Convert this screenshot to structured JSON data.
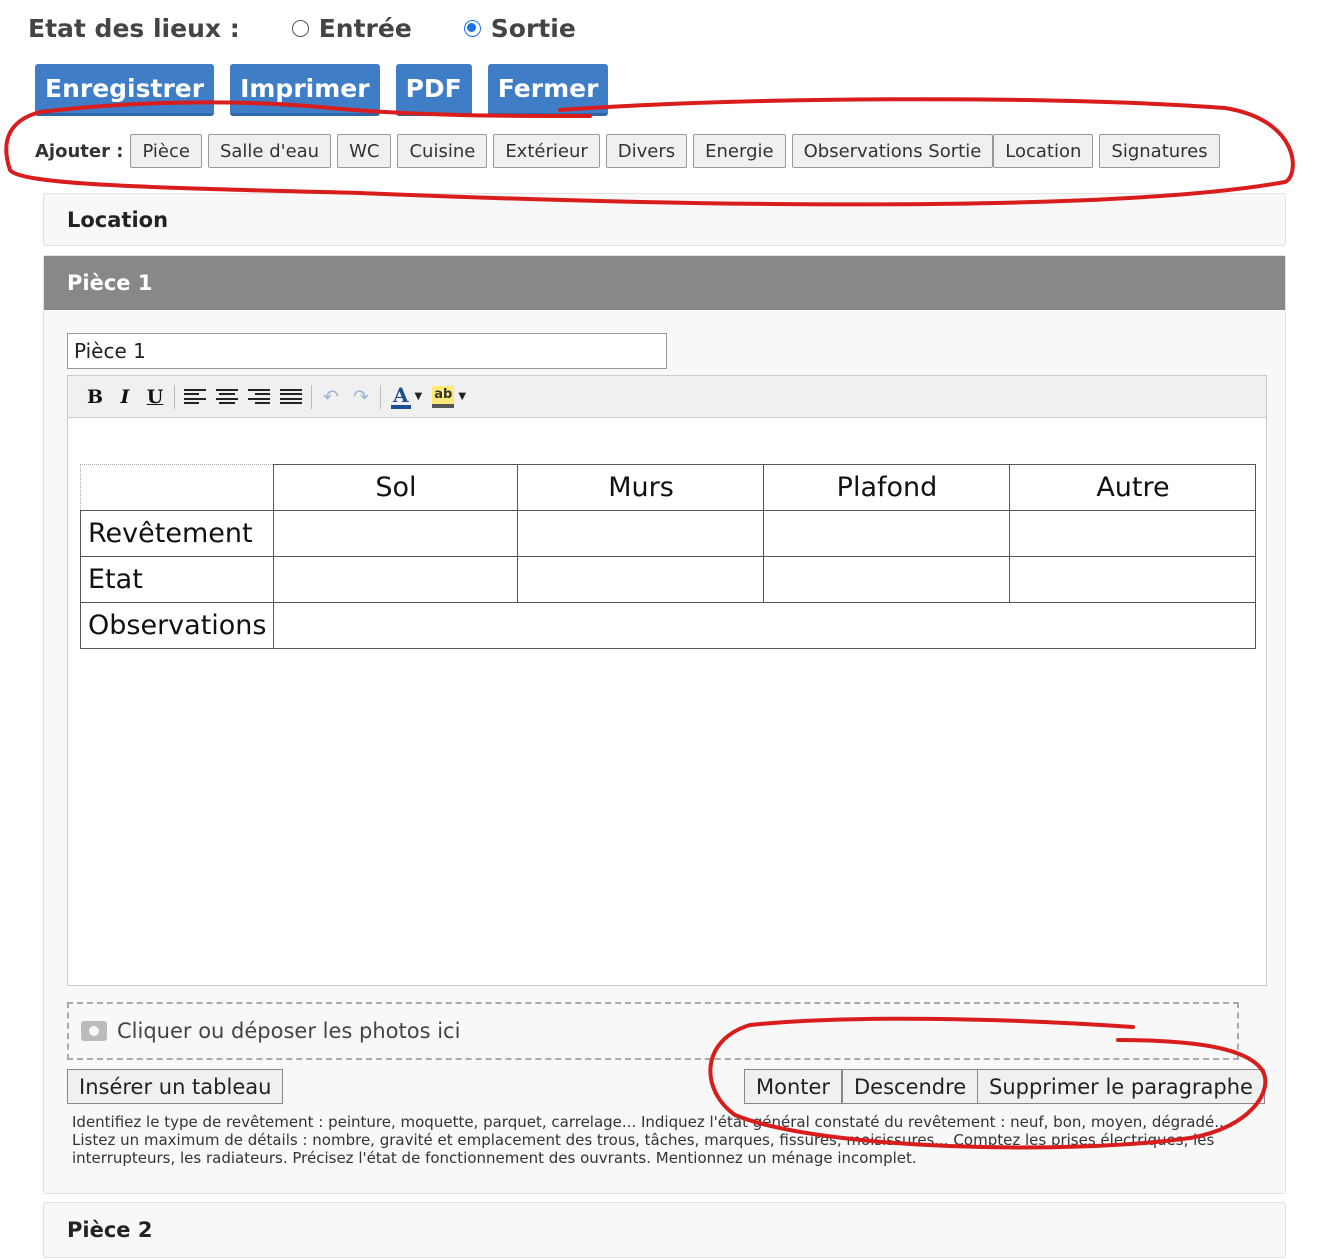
{
  "header": {
    "label": "Etat des lieux :",
    "radios": [
      {
        "label": "Entrée",
        "checked": false
      },
      {
        "label": "Sortie",
        "checked": true
      }
    ]
  },
  "actions": {
    "save": "Enregistrer",
    "print": "Imprimer",
    "pdf": "PDF",
    "close": "Fermer"
  },
  "add_bar": {
    "label": "Ajouter :",
    "buttons": [
      "Pièce",
      "Salle d'eau",
      "WC",
      "Cuisine",
      "Extérieur",
      "Divers",
      "Energie",
      "Observations Sortie",
      "Location",
      "Signatures"
    ]
  },
  "sections": {
    "location": "Location",
    "piece1": "Pièce 1",
    "piece2": "Pièce 2"
  },
  "piece1": {
    "name_value": "Pièce 1",
    "table": {
      "columns": [
        "",
        "Sol",
        "Murs",
        "Plafond",
        "Autre"
      ],
      "rows": [
        "Revêtement",
        "Etat",
        "Observations"
      ]
    },
    "dropzone": "Cliquer ou déposer les photos ici",
    "insert_table": "Insérer un tableau",
    "move_up": "Monter",
    "move_down": "Descendre",
    "delete": "Supprimer le paragraphe",
    "help_text": "Identifiez le type de revêtement : peinture, moquette, parquet, carrelage... Indiquez l'état général constaté du revêtement : neuf, bon, moyen, dégradé.... Listez un maximum de détails : nombre, gravité et emplacement des trous, tâches, marques, fissures, moisissures... Comptez les prises électriques, les interrupteurs, les radiateurs. Précisez l'état de fonctionnement des ouvrants. Mentionnez un ménage incomplet."
  },
  "colors": {
    "primary_button": "#3f7dc6",
    "active_header": "#888888",
    "radio_selected": "#1a73e8",
    "annotation": "#d91c1c"
  }
}
